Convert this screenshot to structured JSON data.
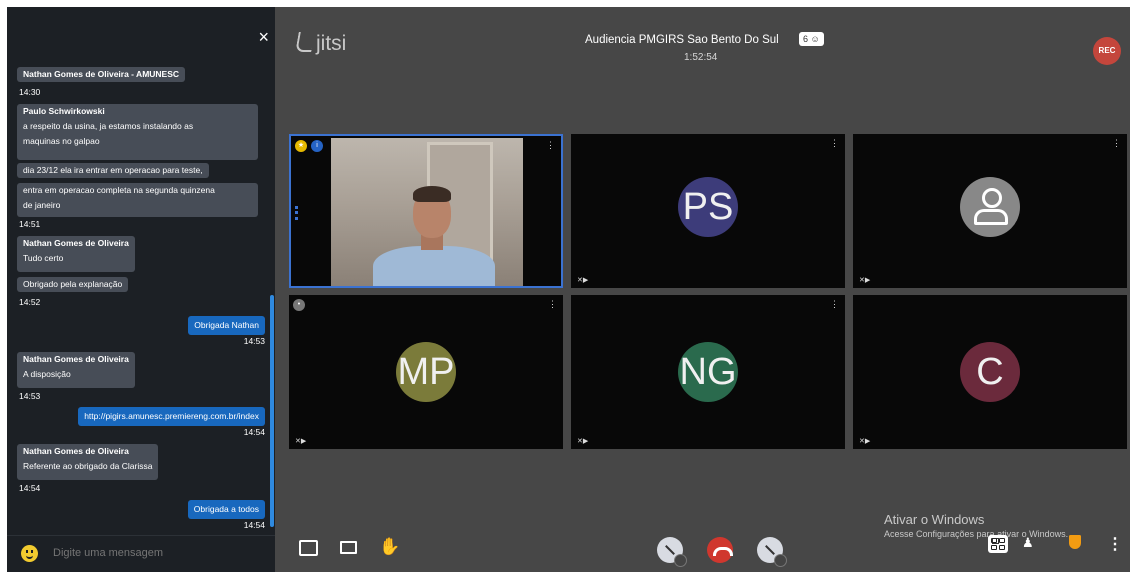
{
  "chat": {
    "close_label": "×",
    "compose_placeholder": "Digite uma mensagem",
    "messages": [
      {
        "sender": "Nathan Gomes de Oliveira - AMUNESC",
        "lines": [],
        "time": "14:30"
      },
      {
        "sender": "Paulo Schwirkowski",
        "lines": [
          "a respeito da usina, ja estamos instalando as",
          "maquinas no galpao",
          "dia 23/12 ela ira entrar em operacao para teste,",
          "entra em operacao completa na segunda quinzena",
          "de janeiro"
        ],
        "time": "14:51"
      },
      {
        "sender": "Nathan Gomes de Oliveira",
        "lines": [
          "Tudo certo",
          "Obrigado pela explanação"
        ],
        "time": "14:52"
      },
      {
        "sender": "",
        "lines": [
          "Obrigada Nathan"
        ],
        "time": "14:53"
      },
      {
        "sender": "Nathan Gomes de Oliveira",
        "lines": [
          "A disposição"
        ],
        "time": "14:53"
      },
      {
        "sender": "",
        "lines": [
          "http://pigirs.amunesc.premiereng.com.br/index"
        ],
        "time": "14:54"
      },
      {
        "sender": "Nathan Gomes de Oliveira",
        "lines": [
          "Referente ao obrigado da Clarissa"
        ],
        "time": "14:54"
      },
      {
        "sender": "",
        "lines": [
          "Obrigada a todos"
        ],
        "time": "14:54"
      }
    ]
  },
  "header": {
    "logo": "jitsi",
    "title": "Audiencia PMGIRS Sao Bento Do Sul",
    "participants_count": "6",
    "timer": "1:52:54",
    "rec_label": "REC"
  },
  "tiles": [
    {
      "initials": "",
      "color": "#000000",
      "type": "video"
    },
    {
      "initials": "PS",
      "color": "#3d3c7a"
    },
    {
      "initials": "",
      "color": "#888888",
      "type": "placeholder"
    },
    {
      "initials": "MP",
      "color": "#7b7b3a"
    },
    {
      "initials": "NG",
      "color": "#2a6a4d"
    },
    {
      "initials": "C",
      "color": "#6b2a3c"
    }
  ],
  "windows_watermark": {
    "title": "Ativar o Windows",
    "subtitle": "Acesse Configurações para ativar o Windows."
  },
  "colors": {
    "own_bubble": "#1868be",
    "other_bubble": "#474d57",
    "hangup": "#d0372e",
    "rec": "#c4463c"
  }
}
